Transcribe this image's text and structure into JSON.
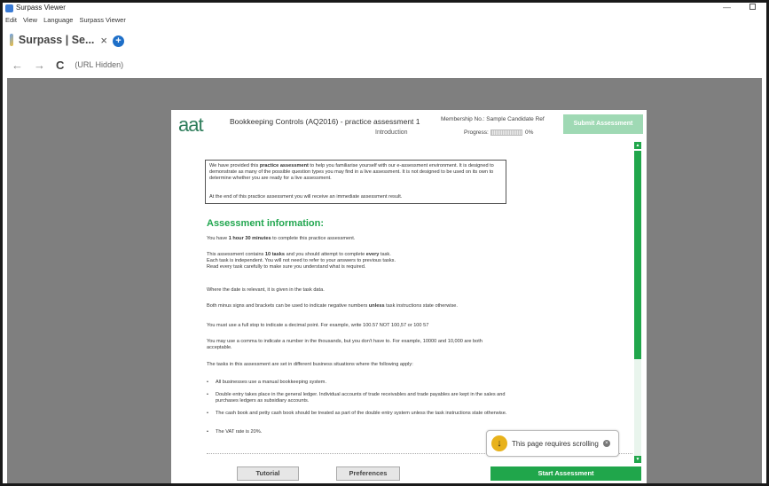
{
  "window": {
    "title": "Surpass Viewer",
    "min_symbol": "—",
    "menu": [
      "Edit",
      "View",
      "Language",
      "Surpass Viewer"
    ]
  },
  "tab": {
    "title": "Surpass | Se...",
    "close": "×",
    "new_tab": "+"
  },
  "address": {
    "back": "←",
    "forward": "→",
    "reload": "C",
    "url": "(URL Hidden)"
  },
  "header": {
    "logo": "aat",
    "course_title": "Bookkeeping Controls (AQ2016) - practice assessment 1",
    "section": "Introduction",
    "membership": "Membership No.: Sample Candidate Ref",
    "progress_label": "Progress:",
    "progress_value": "0%",
    "progress_fraction": 0,
    "submit_label": "Submit Assessment"
  },
  "notice": {
    "line1_pre": "We have provided this ",
    "line1_bold": "practice assessment",
    "line1_post": " to help you familiarise yourself with our e-assessment environment. It is designed to demonstrate as many of the possible question types you may find in a live assessment. It is not designed to be used on its own to determine whether you are ready for a live assessment.",
    "line2": "At the end of this practice assessment you will receive an immediate assessment result."
  },
  "info": {
    "heading": "Assessment information:",
    "time_pre": "You have ",
    "time_bold": "1 hour 30 minutes",
    "time_post": " to complete this practice assessment.",
    "tasks_pre": "This assessment contains ",
    "tasks_bold": "10 tasks",
    "tasks_mid": " and you should attempt to complete ",
    "tasks_bold2": "every",
    "tasks_post": " task.",
    "tasks_line2": "Each task is independent. You will not need to refer to your answers to previous tasks.",
    "tasks_line3": "Read every task carefully to make sure you understand what is required.",
    "date_line": "Where the date is relevant, it is given in the task data.",
    "minus_pre": "Both minus signs and brackets can be used to indicate negative numbers ",
    "minus_bold": "unless",
    "minus_post": " task instructions state otherwise.",
    "fullstop_line": "You must use a full stop to indicate a decimal point. For example, write 100.57 NOT 100,57 or 100 57",
    "comma_line": "You may use a comma to indicate a number in the thousands, but you don't have to. For example, 10000 and 10,000 are both acceptable.",
    "business_line": "The tasks in this assessment are set in different business situations where the following apply:",
    "bullets": [
      "All businesses use a manual bookkeeping system.",
      "Double entry takes place in the general ledger. Individual accounts of trade receivables and trade payables are kept in the sales and purchases ledgers as subsidiary accounts.",
      "The cash book and petty cash book should be treated as part of the double entry system unless the task instructions state otherwise.",
      "The VAT rate is 20%."
    ],
    "bullet_symbol": "•"
  },
  "scroll_tip": {
    "icon": "↓",
    "text": "This page requires scrolling",
    "close": "×"
  },
  "scrollbar": {
    "up": "▲",
    "down": "▼"
  },
  "footer": {
    "tutorial": "Tutorial",
    "preferences": "Preferences",
    "start": "Start Assessment"
  },
  "colors": {
    "accent_green": "#20a64b",
    "submit_disabled": "#9fd9b4",
    "logo_green": "#2e7d5b",
    "tip_icon": "#e8b21b"
  }
}
